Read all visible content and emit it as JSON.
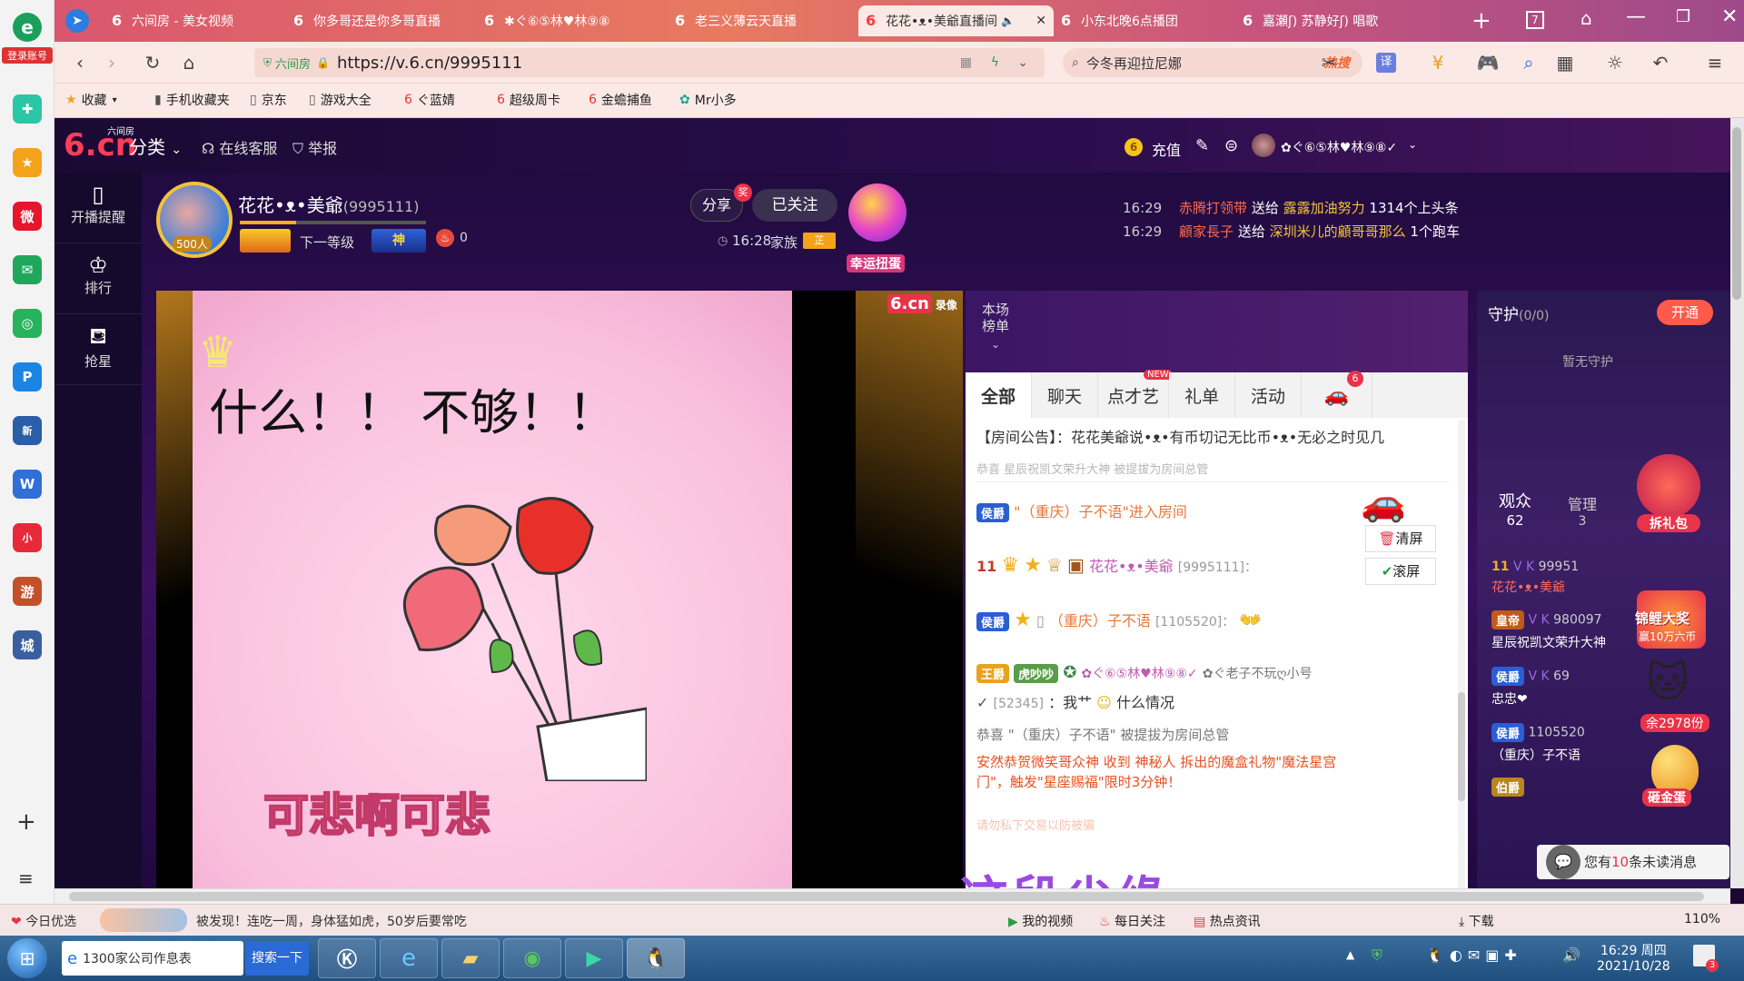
{
  "browser": {
    "login_label": "登录账号",
    "tabs": [
      {
        "title": "六间房 - 美女视频"
      },
      {
        "title": "你多哥还是你多哥直播"
      },
      {
        "title": "✱ぐ⑥⑤林♥林⑨⑧"
      },
      {
        "title": "老三义薄云天直播"
      },
      {
        "title": "花花•ᴥ•美爺直播间"
      },
      {
        "title": "小东北晚6点播团"
      },
      {
        "title": "嘉瀬ʃ) 苏静好ʃ) 唱歌"
      }
    ],
    "tab_count": "7",
    "url_prefix": "六间房",
    "url": "https://v.6.cn/9995111",
    "search_placeholder": "今冬再迎拉尼娜",
    "search_hot": "热搜",
    "translate": "译",
    "bookmarks": [
      "收藏",
      "手机收藏夹",
      "京东",
      "游戏大全",
      "ぐ蓝婧",
      "超级周卡",
      "金蟾捕鱼",
      "Mr小多"
    ]
  },
  "site": {
    "logo_main": "6.cn",
    "logo_sub": "六间房",
    "nav": [
      "分类",
      "在线客服",
      "举报"
    ],
    "recharge": "充值",
    "user_name": "✿ぐ⑥⑤林♥林⑨⑧✓"
  },
  "left_nav": [
    "开播提醒",
    "排行",
    "抢星"
  ],
  "streamer": {
    "name": "花花•ᴥ•美爺",
    "id": "(9995111)",
    "fans": "500人",
    "next_level": "下一等级",
    "level_badge": "神",
    "heat": "0",
    "share": "分享",
    "share_badge": "奖",
    "follow": "已关注",
    "time": "16:28",
    "family": "家族",
    "family_badge": "芷",
    "lucky_egg": "幸运扭蛋"
  },
  "ticker": [
    {
      "time": "16:29",
      "from": "赤腾打领带",
      "verb": "送给",
      "to": "露露加油努力",
      "gift": "1314个上头条"
    },
    {
      "time": "16:29",
      "from": "顧家長子",
      "verb": "送给",
      "to": "深圳米儿的顧哥哥那么",
      "gift": "1个跑车"
    }
  ],
  "video": {
    "watermark": "6.cn",
    "watermark_sub": "录像",
    "caption_top": "什么！！ 不够！！",
    "caption_bottom": "可悲啊可悲"
  },
  "chat": {
    "rank_label": "本场榜单",
    "tabs": [
      "全部",
      "聊天",
      "点才艺",
      "礼单",
      "活动"
    ],
    "new_badge": "NEW",
    "car_count": "6",
    "announcement": "【房间公告】：花花美爺说•ᴥ•有币切记无比币•ᴥ•无必之时见几",
    "faded": "恭喜  星辰祝凯文荣升大神  被提拔为房间总管",
    "clear_screen": "清屏",
    "scroll_screen": "滚屏",
    "messages": [
      {
        "badge": "侯爵",
        "text": "\"（重庆）子不语\"进入房间"
      },
      {
        "level": "11",
        "name": "花花•ᴥ•美爺",
        "uid": "[9995111]："
      },
      {
        "badge": "侯爵",
        "name": "（重庆）子不语",
        "uid": "[1105520]："
      },
      {
        "badge": "王爵",
        "tag": "虎吵吵",
        "name": "✿ぐ⑥⑤林♥林⑨⑧✓",
        "name2": "✿ぐ老子不玩ღ小号",
        "uid": "[52345]",
        "text": "：我艹",
        "text2": "什么情况"
      },
      {
        "text": "恭喜 \"（重庆）子不语\" 被提拔为房间总管"
      },
      {
        "text": "安然恭贺微笑哥众神 收到 神秘人 拆出的魔盒礼物\"魔法星宫门\"，触发\"星座赐福\"限时3分钟！"
      },
      {
        "text": "请勿私下交易以防被骗"
      }
    ]
  },
  "guard": {
    "title": "守护",
    "count": "(0/0)",
    "open": "开通",
    "none": "暂无守护",
    "audience": "观众",
    "audience_count": "62",
    "manage": "管理",
    "manage_count": "3",
    "gift_pack": "拆礼包",
    "promo_big": "锦鲤大奖",
    "promo_sub": "赢10万六币",
    "remain": "余2978份",
    "smash": "砸金蛋",
    "unread_prefix": "您有",
    "unread_num": "10",
    "unread_suffix": "条未读消息",
    "users": [
      {
        "level": "11",
        "badges": "V K",
        "id": "99951",
        "name": "花花•ᴥ•美爺"
      },
      {
        "badge": "皇帝",
        "badges": "V K",
        "id": "980097",
        "name": "星辰祝凯文荣升大神"
      },
      {
        "badge": "侯爵",
        "badges": "V K",
        "id": "69",
        "name": "忠忠❤"
      },
      {
        "badge": "侯爵",
        "id": "1105520",
        "name": "（重庆）子不语"
      },
      {
        "badge": "伯爵",
        "id": "",
        "name": ""
      }
    ]
  },
  "overlay_text": "这段尘缘",
  "status_bar": {
    "left": "今日优选",
    "news": "被发现！连吃一周，身体猛如虎，50岁后要常吃",
    "items": [
      "我的视频",
      "每日关注",
      "热点资讯",
      "下载"
    ],
    "zoom": "110%"
  },
  "taskbar": {
    "app_label": "1300家公司作息表",
    "search_btn": "搜索一下",
    "time": "16:29 周四",
    "date": "2021/10/28",
    "notif_count": "3"
  },
  "colors": {
    "accent_red": "#e8334a",
    "chat_orange": "#e85020",
    "guard_purple": "#3d1f66"
  }
}
